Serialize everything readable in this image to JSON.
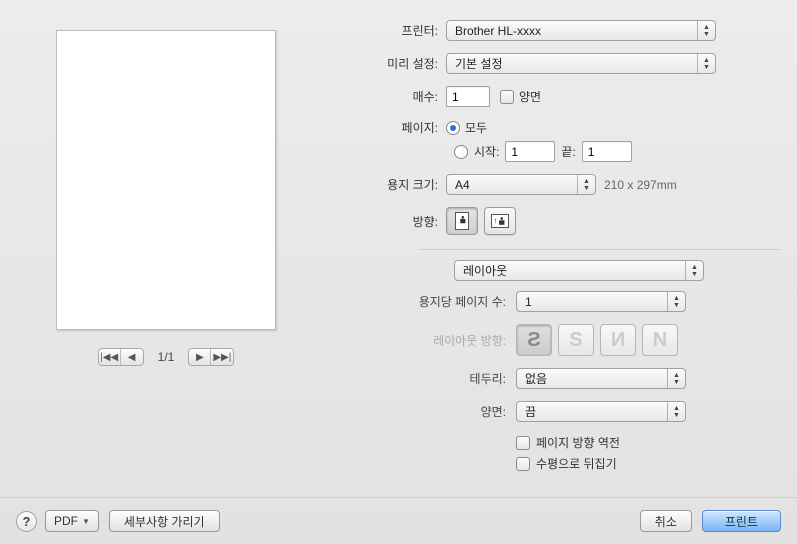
{
  "labels": {
    "printer": "프린터:",
    "preset": "미리 설정:",
    "copies": "매수:",
    "two_sided": "양면",
    "pages": "페이지:",
    "all": "모두",
    "from": "시작:",
    "to": "끝:",
    "paper_size": "용지 크기:",
    "orientation": "방향:",
    "pages_per_sheet": "용지당 페이지 수:",
    "layout_direction": "레이아웃 방향:",
    "border": "테두리:",
    "duplex": "양면:",
    "reverse_orientation": "페이지 방향 역전",
    "flip_horizontal": "수평으로 뒤집기"
  },
  "values": {
    "printer": "Brother HL-xxxx",
    "preset": "기본 설정",
    "copies": "1",
    "pages_from": "1",
    "pages_to": "1",
    "paper_size": "A4",
    "paper_dim": "210 x 297mm",
    "section": "레이아웃",
    "pages_per_sheet": "1",
    "border": "없음",
    "duplex": "끔"
  },
  "page_counter": "1/1",
  "footer": {
    "pdf": "PDF",
    "hide_details": "세부사항 가리기",
    "cancel": "취소",
    "print": "프린트",
    "help": "?"
  }
}
